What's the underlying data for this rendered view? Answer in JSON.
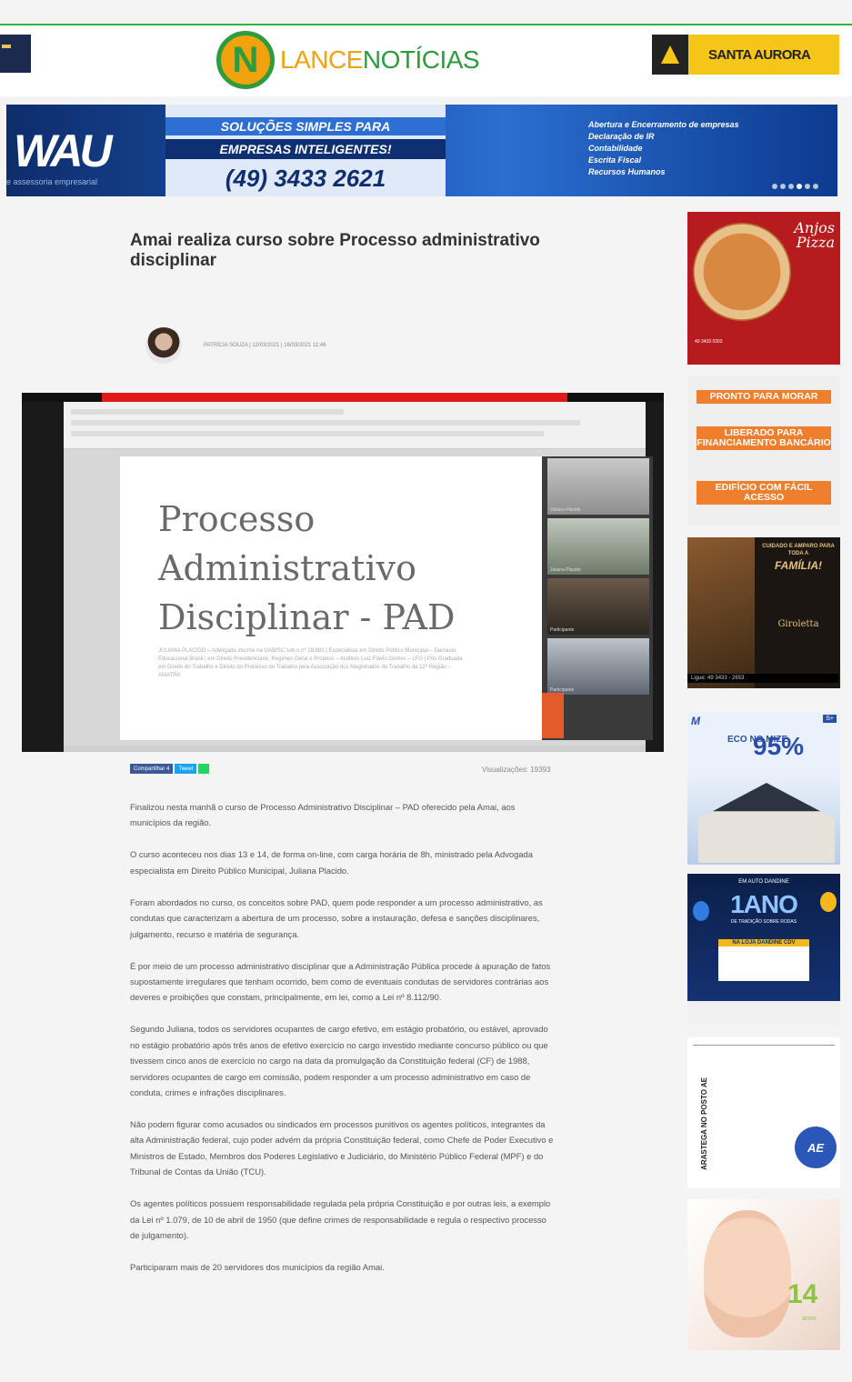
{
  "header": {
    "logo_letter": "N",
    "logo_part1": "LANCE",
    "logo_part2": "NOTÍCIAS",
    "right_ad_text": "SANTA AURORA",
    "brand_green": "#2e9b3c",
    "brand_orange": "#f2a20c"
  },
  "banner": {
    "brand": "WAU",
    "brand_sub": "e assessoria empresarial",
    "line1": "SOLUÇÕES SIMPLES PARA",
    "line2": "EMPRESAS INTELIGENTES!",
    "phone": "(49) 3433 2621",
    "services": [
      "Abertura e Encerramento de empresas",
      "Declaração de IR",
      "Contabilidade",
      "Escrita Fiscal",
      "Recursos Humanos"
    ],
    "dots_total": 6,
    "dot_active": 3
  },
  "article": {
    "title": "Amai realiza curso sobre Processo administrativo disciplinar",
    "author_meta": "PATRÍCIA SOUZA | 12/03/2021 | 16/03/2021 11:46",
    "share_facebook": "Compartilhar 4",
    "share_twitter": "Tweet",
    "views": "Visualizações: 19393",
    "paragraphs": [
      "Finalizou nesta manhã o curso de Processo Administrativo Disciplinar – PAD oferecido pela Amai, aos municípios da região.",
      "O curso aconteceu nos dias 13 e 14, de forma on-line, com carga horária de 8h, ministrado pela Advogada especialista em Direito Público Municipal, Juliana Placido.",
      "Foram abordados no curso, os conceitos sobre PAD, quem pode responder a um processo administrativo, as condutas que caracterizam a abertura de um processo, sobre a instauração, defesa e sanções disciplinares, julgamento, recurso e matéria de segurança.",
      "É por meio de um processo administrativo disciplinar que a Administração Pública procede à apuração de fatos supostamente irregulares que tenham ocorrido, bem como de eventuais condutas de servidores contrárias aos deveres e proibições que constam, principalmente, em lei, como a Lei nº 8.112/90.",
      "Segundo Juliana, todos os servidores ocupantes de cargo efetivo, em estágio probatório, ou estável, aprovado no estágio probatório após três anos de efetivo exercício no cargo investido mediante concurso público ou que tivessem cinco anos de exercício no cargo na data da promulgação da Constituição federal (CF) de 1988, servidores ocupantes de cargo em comissão, podem responder a um processo administrativo em caso de conduta, crimes e infrações disciplinares.",
      "Não podem figurar como acusados ou sindicados em processos punitivos os agentes políticos, integrantes da alta Administração federal, cujo poder advém da própria Constituição federal, como Chefe de Poder Executivo e Ministros de Estado, Membros dos Poderes Legislativo e Judiciário, do Ministério Público Federal (MPF) e do Tribunal de Contas da União (TCU).",
      "Os agentes políticos possuem responsabilidade regulada pela própria Constituição e por outras leis, a exemplo da Lei nº 1.079, de 10 de abril de 1950 (que define crimes de responsabilidade e regula o respectivo processo de julgamento).",
      "Participaram mais de 20 servidores dos municípios da região Amai."
    ]
  },
  "video": {
    "slide_line1": "Processo",
    "slide_line2": "Administrativo",
    "slide_line3": "Disciplinar - PAD",
    "slide_credit": "JULIANA PLACIDO – Advogada inscrita na OAB/SC sob o nº 28.883 | Especialista em Direito Público Municipal – Damásio Educacional Brasil | em Direito Previdenciário, Regimes Geral e Próprios – Instituto Luiz Flávio Gomes – LFG | Pós Graduada em Direito do Trabalho e Direito do Processo do Trabalho pela Associação dos Magistrados do Trabalho da 12ª Região – AMATRA",
    "participant_names": [
      "Juliana Placido",
      "Juliana Placido",
      "Participante",
      "Participante"
    ]
  },
  "sidebar": {
    "pizza_brand1": "Anjos",
    "pizza_brand2": "Pizza",
    "pizza_foot": "49 3433 0303",
    "prop_btn1": "PRONTO PARA MORAR",
    "prop_btn2": "LIBERADO PARA FINANCIAMENTO BANCÁRIO",
    "prop_btn3": "EDIFÍCIO COM FÁCIL ACESSO",
    "gir_top": "CUIDADO E AMPARO PARA TODA A",
    "gir_big": "FAMÍLIA!",
    "gir_logo": "Giroletta",
    "gir_phone": "Ligue: 49 3433 - 2653",
    "eco_mark": "M",
    "eco_badge": "S+",
    "eco_word": "ECO NO MIZE",
    "eco_pct": "95%",
    "ano_top": "EM AUTO DANDINE",
    "ano_big": "1ANO",
    "ano_sub": "DE TRADIÇÃO SOBRE RODAS",
    "ano_box": "NA LOJA DANDINE CDV",
    "aeb_text": "ARASTEGA NO POSTO AE",
    "aeb_logo": "AE",
    "baby_num": "14",
    "baby_sub": "anos"
  }
}
